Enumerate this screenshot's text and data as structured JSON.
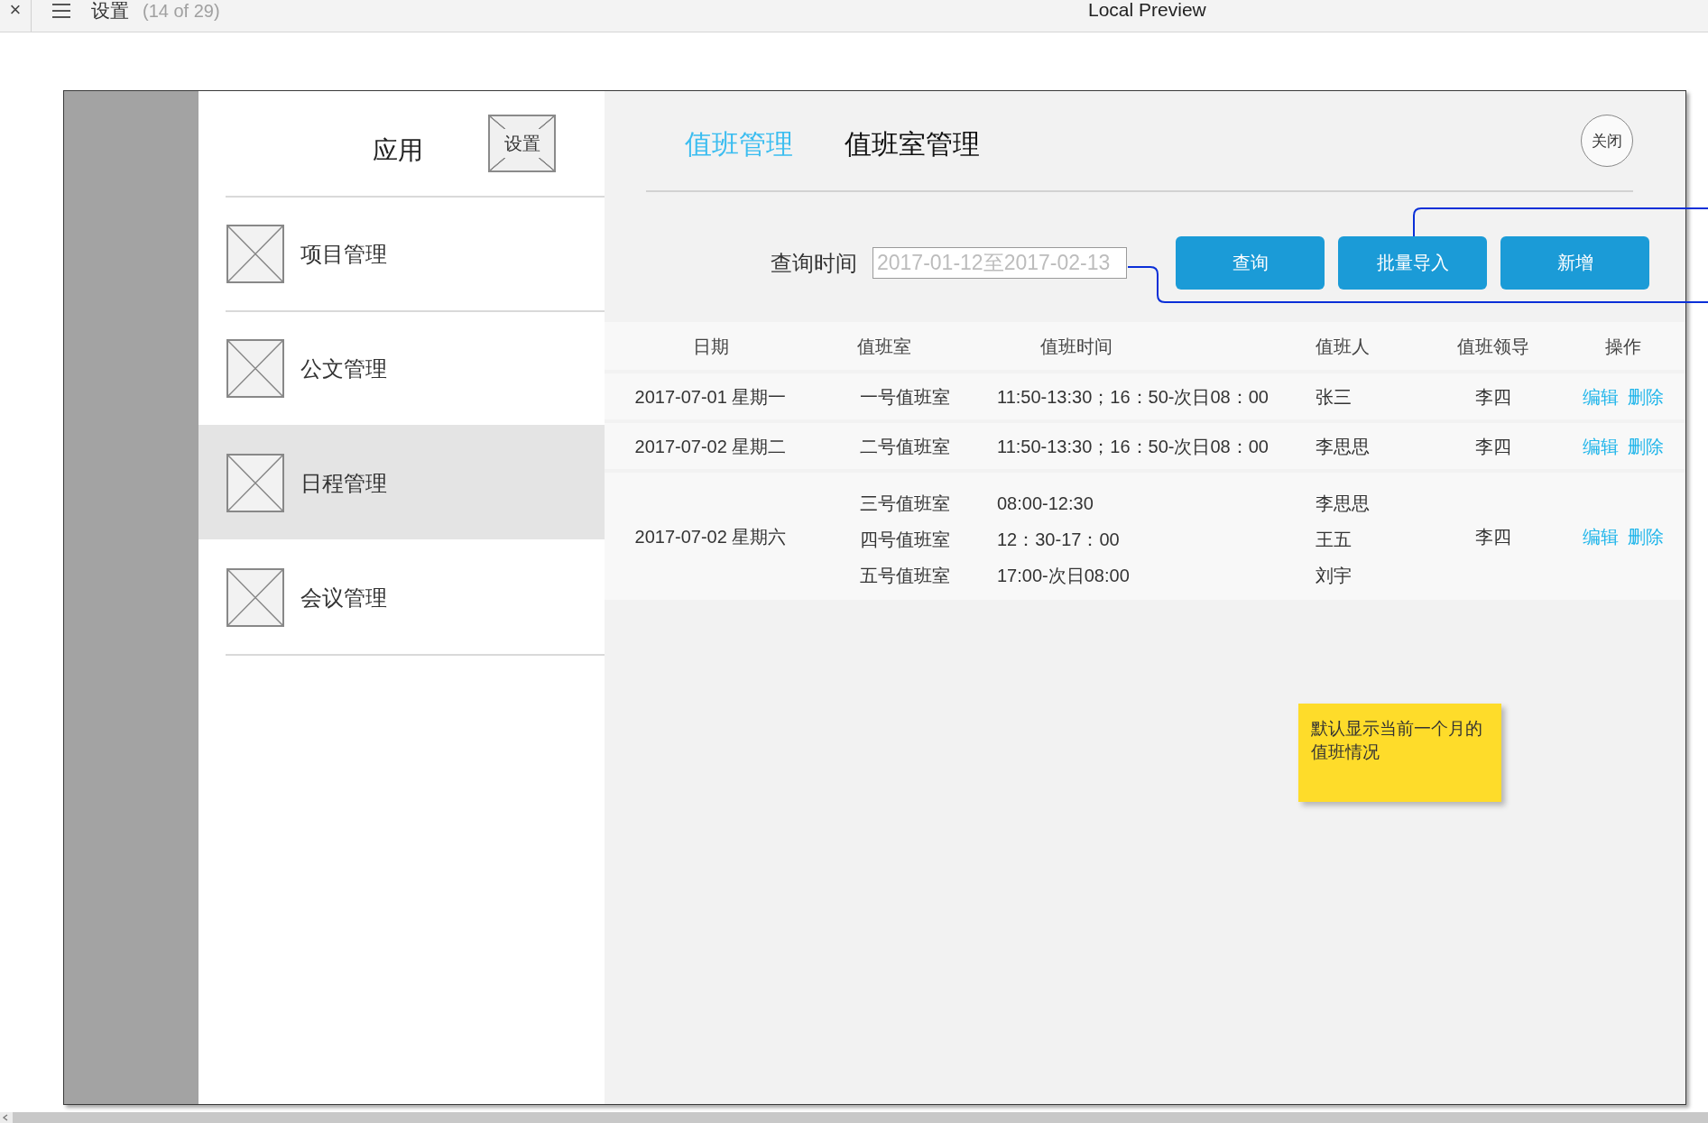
{
  "viewer": {
    "close": "×",
    "page": "设置",
    "page_count": "(14 of 29)",
    "title": "Local Preview"
  },
  "sidebar": {
    "title": "应用",
    "settings": "设置",
    "items": [
      {
        "label": "项目管理",
        "selected": false
      },
      {
        "label": "公文管理",
        "selected": false
      },
      {
        "label": "日程管理",
        "selected": true
      },
      {
        "label": "会议管理",
        "selected": false
      }
    ]
  },
  "tabs": [
    {
      "label": "值班管理",
      "selected": true
    },
    {
      "label": "值班室管理",
      "selected": false
    }
  ],
  "close_button": "关闭",
  "query": {
    "label": "查询时间",
    "placeholder": "2017-01-12至2017-02-13"
  },
  "buttons": [
    "查询",
    "批量导入",
    "新增"
  ],
  "table": {
    "columns": [
      "日期",
      "值班室",
      "值班时间",
      "值班人",
      "值班领导",
      "操作"
    ],
    "rows": [
      {
        "date": "2017-07-01 星期一",
        "rooms": [
          "一号值班室"
        ],
        "times": [
          "11:50-13:30；16：50-次日08：00"
        ],
        "people": [
          "张三"
        ],
        "leader": "李四",
        "actions": [
          "编辑",
          "删除"
        ]
      },
      {
        "date": "2017-07-02 星期二",
        "rooms": [
          "二号值班室"
        ],
        "times": [
          "11:50-13:30；16：50-次日08：00"
        ],
        "people": [
          "李思思"
        ],
        "leader": "李四",
        "actions": [
          "编辑",
          "删除"
        ]
      },
      {
        "date": "2017-07-02 星期六",
        "rooms": [
          "三号值班室",
          "四号值班室",
          "五号值班室"
        ],
        "times": [
          "08:00-12:30",
          "12：30-17：00",
          "17:00-次日08:00"
        ],
        "people": [
          "李思思",
          "王五",
          "刘宇"
        ],
        "leader": "李四",
        "actions": [
          "编辑",
          "删除"
        ]
      }
    ]
  },
  "note": "默认显示当前一个月的值班情况"
}
